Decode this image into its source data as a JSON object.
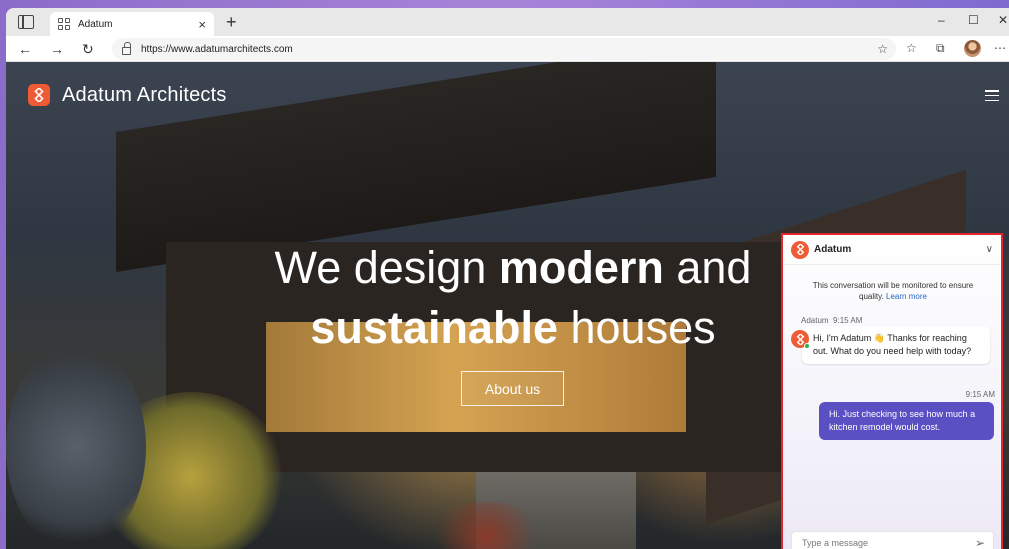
{
  "browser": {
    "tab_title": "Adatum",
    "url": "https://www.adatumarchitects.com",
    "new_tab_symbol": "+",
    "tab_close_symbol": "×",
    "controls": {
      "minimize": "–",
      "maximize": "☐",
      "close": "✕"
    },
    "icons": [
      "back-arrow-icon",
      "forward-arrow-icon",
      "refresh-icon",
      "lock-icon",
      "favorite-star-icon",
      "favorites-icon",
      "collections-icon",
      "profile-avatar",
      "more-icon"
    ]
  },
  "site": {
    "brand": "Adatum Architects",
    "brand_color": "#ef5b34",
    "hero": {
      "line1_normal": "We design ",
      "line1_bold": "modern",
      "line1_tail": " and",
      "line2_bold": "sustainable",
      "line2_tail": " houses"
    },
    "cta": "About us"
  },
  "chat": {
    "title": "Adatum",
    "notice": "This conversation will be monitored to ensure quality.",
    "notice_link": "Learn more",
    "bot_sender": "Adatum",
    "bot_time": "9:15 AM",
    "bot_message": "Hi, I'm Adatum 👋 Thanks for reaching out. What do you need help with today?",
    "user_time": "9:15 AM",
    "user_message": "Hi. Just checking to see how much a kitchen remodel would cost.",
    "input_placeholder": "Type a message",
    "accent": "#5b4fc4",
    "highlight_border": "#e3262e"
  }
}
